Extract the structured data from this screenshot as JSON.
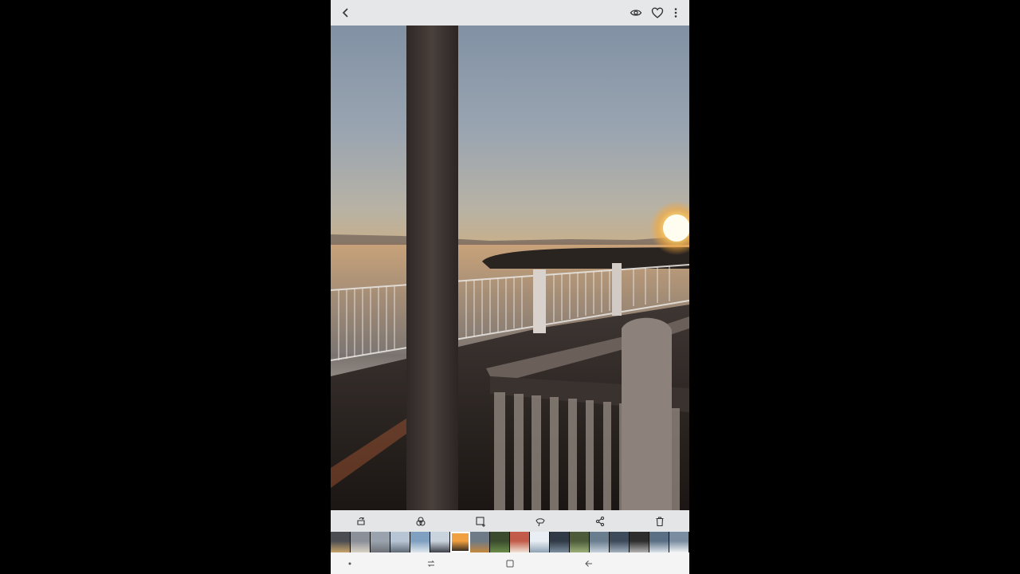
{
  "screen": "photo-viewer",
  "topbar": {
    "icons": [
      "back-icon",
      "eye-icon",
      "heart-icon",
      "more-vert-icon"
    ]
  },
  "toolbar": {
    "icons": [
      "rotate-icon",
      "filter-icon",
      "adjust-icon",
      "brush-icon",
      "share-icon",
      "delete-icon"
    ]
  },
  "filmstrip": {
    "thumbnails": [
      {
        "colors": [
          "#4a4c52",
          "#c7a46a"
        ]
      },
      {
        "colors": [
          "#8a8f98",
          "#d9d2c4"
        ]
      },
      {
        "colors": [
          "#9aa3ad",
          "#6c6f75"
        ]
      },
      {
        "colors": [
          "#b7c4d3",
          "#5f6a76"
        ]
      },
      {
        "colors": [
          "#7fa0c1",
          "#e0e6ed"
        ]
      },
      {
        "colors": [
          "#c9d3de",
          "#3e4149"
        ]
      },
      {
        "colors": [
          "#f0a040",
          "#1b1b1b"
        ],
        "selected": true
      },
      {
        "colors": [
          "#6e7a86",
          "#c4873d"
        ]
      },
      {
        "colors": [
          "#3b4c2e",
          "#6b8c4a"
        ]
      },
      {
        "colors": [
          "#c25b4a",
          "#f1e4d6"
        ]
      },
      {
        "colors": [
          "#e8eef3",
          "#8fa3b6"
        ]
      },
      {
        "colors": [
          "#2f3a46",
          "#7c8f9f"
        ]
      },
      {
        "colors": [
          "#4d5b3a",
          "#9db07a"
        ]
      },
      {
        "colors": [
          "#6a7d8f",
          "#c8d2dc"
        ]
      },
      {
        "colors": [
          "#3d4a5a",
          "#a3b1bf"
        ]
      },
      {
        "colors": [
          "#2d2d2d",
          "#b2b2b2"
        ]
      },
      {
        "colors": [
          "#5a6e84",
          "#dbe3ea"
        ]
      },
      {
        "colors": [
          "#7a8da0",
          "#f2f4f6"
        ]
      }
    ]
  },
  "navbar": {
    "icons": [
      "dot-icon",
      "recents-icon",
      "home-icon",
      "back-nav-icon"
    ]
  },
  "colors": {
    "topbar_bg": "#e6e7e9",
    "toolbar_bg": "#e4e5e7",
    "navbar_bg": "#f4f4f5",
    "icon": "#333333"
  }
}
